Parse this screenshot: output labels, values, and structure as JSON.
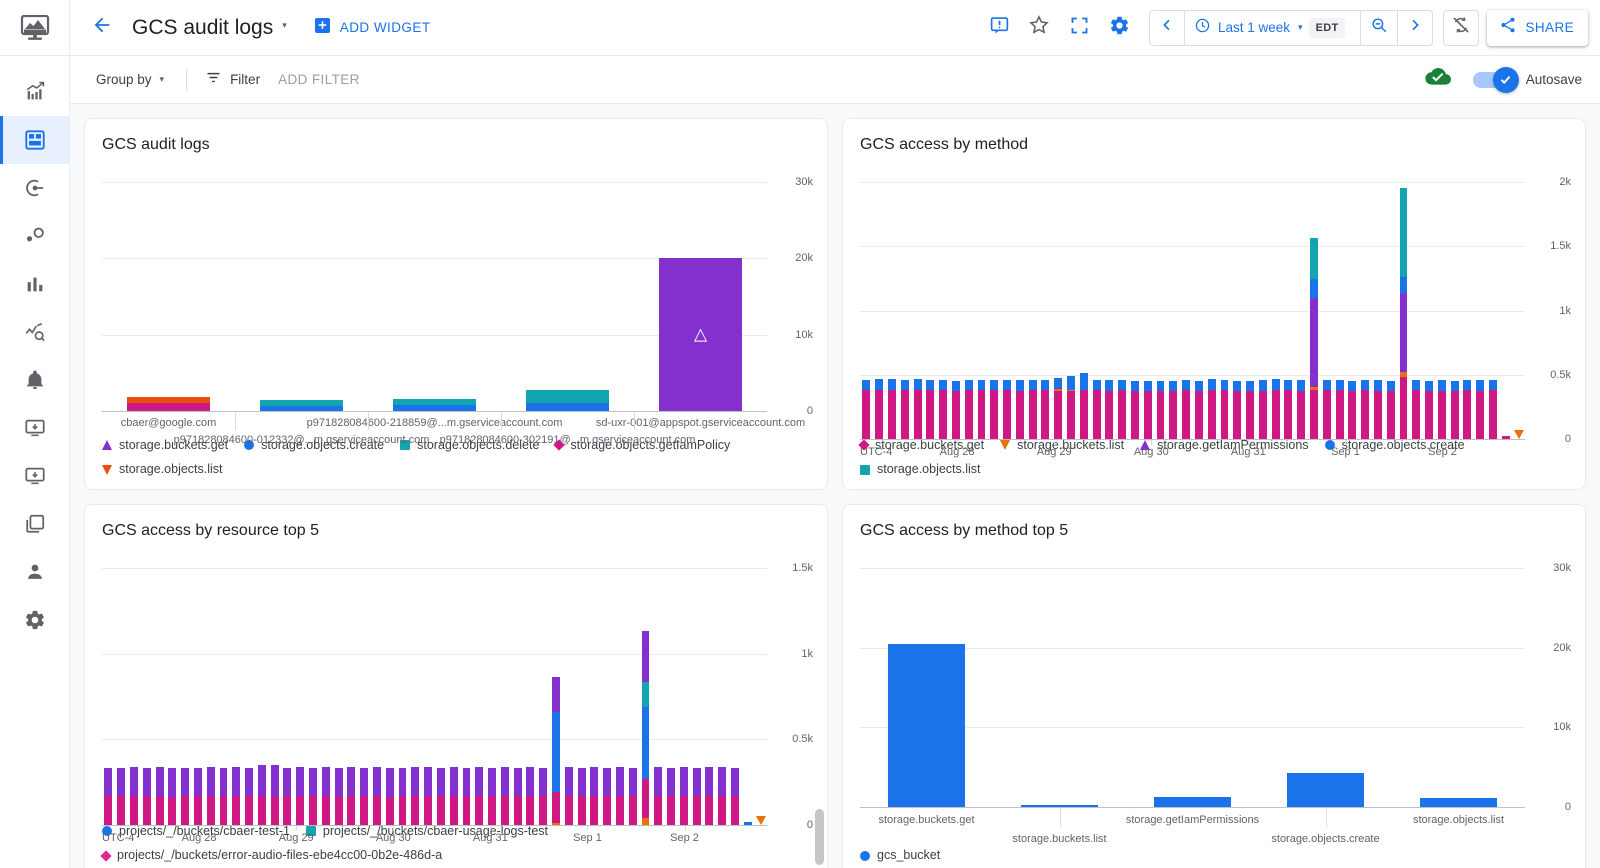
{
  "app": {
    "logo_icon": "monitoring-logo-icon"
  },
  "rail": {
    "items": [
      {
        "name": "overview",
        "icon": "chart-up-icon",
        "active": false
      },
      {
        "name": "dashboards",
        "icon": "dashboard-grid-icon",
        "active": true
      },
      {
        "name": "services",
        "icon": "target-arrow-icon",
        "active": false
      },
      {
        "name": "slo",
        "icon": "nodes-icon",
        "active": false
      },
      {
        "name": "metrics",
        "icon": "bar-chart-icon",
        "active": false
      },
      {
        "name": "explorer",
        "icon": "metric-explorer-icon",
        "active": false
      },
      {
        "name": "alerting",
        "icon": "bell-icon",
        "active": false
      },
      {
        "name": "uptime",
        "icon": "monitor-in-icon",
        "active": false
      },
      {
        "name": "groups",
        "icon": "monitor-in-2-icon",
        "active": false
      },
      {
        "name": "copies",
        "icon": "copy-icon",
        "active": false
      },
      {
        "name": "account",
        "icon": "person-icon",
        "active": false
      },
      {
        "name": "settings",
        "icon": "gear-icon",
        "active": false
      }
    ]
  },
  "topbar": {
    "back_icon": "arrow-back-icon",
    "title": "GCS audit logs",
    "title_caret": "▾",
    "add_widget_label": "ADD WIDGET",
    "add_widget_icon": "add-box-icon",
    "actions": [
      {
        "name": "feedback",
        "icon": "feedback-icon"
      },
      {
        "name": "star",
        "icon": "star-outline-icon"
      },
      {
        "name": "fullscreen",
        "icon": "fullscreen-icon"
      },
      {
        "name": "settings",
        "icon": "gear-icon"
      }
    ],
    "time_prev_icon": "chevron-left-icon",
    "time_clock_icon": "clock-icon",
    "time_range": "Last 1 week",
    "time_caret": "▾",
    "timezone": "EDT",
    "time_zoom_icon": "zoom-out-icon",
    "time_next_icon": "chevron-right-icon",
    "refresh_off_icon": "sync-disabled-icon",
    "share_icon": "share-icon",
    "share_label": "SHARE"
  },
  "filterbar": {
    "group_by_label": "Group by",
    "group_by_caret": "▾",
    "filter_icon": "filter-icon",
    "filter_label": "Filter",
    "add_filter_label": "ADD FILTER",
    "saved_icon": "cloud-done-icon",
    "autosave_label": "Autosave",
    "autosave_on": true
  },
  "colors": {
    "blue": "#1a73e8",
    "purple": "#8430ce",
    "magenta": "#d01884",
    "pink": "#e52592",
    "teal": "#12a4af",
    "orange": "#e8710a",
    "red_orange": "#e8500a",
    "green": "#188038",
    "grey_text": "#5f6368"
  },
  "chart_data": [
    {
      "id": "gcs-audit-logs",
      "type": "bar",
      "stacked": true,
      "title": "GCS audit logs",
      "xlabel": "",
      "ylabel": "",
      "ylim": [
        0,
        30000
      ],
      "yticks": [
        0,
        10000,
        20000,
        30000
      ],
      "ytick_labels": [
        "0",
        "10k",
        "20k",
        "30k"
      ],
      "grid": true,
      "legend_position": "bottom",
      "categories": [
        "cbaer@google.com",
        "p971828084600-012332@...m.gserviceaccount.com",
        "p971828084600-218859@...m.gserviceaccount.com",
        "p971828084600-302191@...m.gserviceaccount.com",
        "sd-uxr-001@appspot.gserviceaccount.com"
      ],
      "series": [
        {
          "name": "storage.buckets.get",
          "marker": "tri",
          "color": "#8430ce",
          "values": [
            0,
            0,
            0,
            0,
            20000
          ]
        },
        {
          "name": "storage.objects.create",
          "marker": "circle",
          "color": "#1a73e8",
          "values": [
            0,
            700,
            800,
            1100,
            0
          ]
        },
        {
          "name": "storage.objects.delete",
          "marker": "square",
          "color": "#12a4af",
          "values": [
            0,
            800,
            800,
            1600,
            0
          ]
        },
        {
          "name": "storage.objects.getIamPolicy",
          "marker": "diamond",
          "color": "#d01884",
          "values": [
            1000,
            0,
            0,
            0,
            0
          ]
        },
        {
          "name": "storage.objects.list",
          "marker": "tridown",
          "color": "#e8500a",
          "values": [
            800,
            0,
            0,
            0,
            0
          ]
        }
      ],
      "bar_glyph": "△",
      "bar_glyph_on_category": "sd-uxr-001@appspot.gserviceaccount.com"
    },
    {
      "id": "gcs-access-by-method",
      "type": "bar",
      "stacked": true,
      "title": "GCS access by method",
      "xlabel": "",
      "ylabel": "",
      "ylim": [
        0,
        2000
      ],
      "yticks": [
        0,
        500,
        1000,
        1500,
        2000
      ],
      "ytick_labels": [
        "0",
        "0.5k",
        "1k",
        "1.5k",
        "2k"
      ],
      "grid": true,
      "legend_position": "bottom",
      "xtick_labels": [
        "UTC-4",
        "Aug 28",
        "Aug 29",
        "Aug 30",
        "Aug 31",
        "Sep 1",
        "Sep 2"
      ],
      "xtick_positions": [
        0,
        14.6,
        29.2,
        43.8,
        58.4,
        73.0,
        87.6
      ],
      "n_bars": 48,
      "series_names": [
        "storage.buckets.get",
        "storage.buckets.list",
        "storage.getIamPermissions",
        "storage.objects.create",
        "storage.objects.list"
      ],
      "series_markers": [
        "diamond",
        "tridown",
        "tri",
        "circle",
        "square"
      ],
      "series_colors": [
        "#d01884",
        "#e8710a",
        "#8430ce",
        "#1a73e8",
        "#12a4af"
      ],
      "stacks": [
        [
          380,
          0,
          0,
          80,
          0
        ],
        [
          385,
          0,
          0,
          80,
          0
        ],
        [
          382,
          0,
          0,
          82,
          0
        ],
        [
          380,
          0,
          0,
          78,
          0
        ],
        [
          385,
          0,
          0,
          80,
          0
        ],
        [
          378,
          0,
          0,
          80,
          0
        ],
        [
          380,
          0,
          0,
          78,
          0
        ],
        [
          372,
          0,
          0,
          80,
          0
        ],
        [
          382,
          0,
          0,
          80,
          0
        ],
        [
          378,
          0,
          0,
          82,
          0
        ],
        [
          380,
          0,
          0,
          80,
          0
        ],
        [
          378,
          0,
          0,
          80,
          0
        ],
        [
          376,
          0,
          0,
          80,
          0
        ],
        [
          380,
          0,
          0,
          80,
          0
        ],
        [
          378,
          0,
          0,
          78,
          0
        ],
        [
          370,
          18,
          10,
          78,
          0
        ],
        [
          372,
          8,
          0,
          110,
          0
        ],
        [
          380,
          0,
          0,
          130,
          0
        ],
        [
          380,
          0,
          0,
          80,
          0
        ],
        [
          375,
          0,
          0,
          85,
          0
        ],
        [
          378,
          0,
          0,
          80,
          0
        ],
        [
          372,
          0,
          0,
          80,
          0
        ],
        [
          376,
          0,
          0,
          78,
          0
        ],
        [
          375,
          0,
          0,
          80,
          0
        ],
        [
          372,
          0,
          0,
          80,
          0
        ],
        [
          378,
          0,
          0,
          82,
          0
        ],
        [
          374,
          0,
          0,
          80,
          0
        ],
        [
          380,
          0,
          0,
          88,
          0
        ],
        [
          382,
          0,
          0,
          80,
          0
        ],
        [
          375,
          0,
          0,
          80,
          0
        ],
        [
          372,
          0,
          0,
          80,
          0
        ],
        [
          376,
          0,
          0,
          80,
          0
        ],
        [
          382,
          0,
          0,
          88,
          0
        ],
        [
          378,
          0,
          0,
          80,
          0
        ],
        [
          376,
          0,
          0,
          80,
          0
        ],
        [
          380,
          25,
          690,
          150,
          320
        ],
        [
          378,
          0,
          0,
          80,
          0
        ],
        [
          380,
          0,
          0,
          80,
          0
        ],
        [
          375,
          0,
          0,
          80,
          0
        ],
        [
          378,
          0,
          0,
          80,
          0
        ],
        [
          376,
          0,
          0,
          80,
          0
        ],
        [
          370,
          0,
          0,
          78,
          0
        ],
        [
          480,
          40,
          620,
          120,
          690
        ],
        [
          378,
          0,
          0,
          80,
          0
        ],
        [
          372,
          0,
          0,
          80,
          0
        ],
        [
          376,
          0,
          0,
          80,
          0
        ],
        [
          374,
          0,
          0,
          80,
          0
        ],
        [
          378,
          0,
          0,
          80,
          0
        ],
        [
          376,
          0,
          0,
          80,
          0
        ],
        [
          380,
          0,
          0,
          80,
          0
        ],
        [
          25,
          0,
          0,
          0,
          0
        ]
      ],
      "end_marker": {
        "icon": "tridown",
        "color": "#e8710a"
      }
    },
    {
      "id": "gcs-access-by-resource-top-5",
      "type": "bar",
      "stacked": true,
      "title": "GCS access by resource top 5",
      "xlabel": "",
      "ylabel": "",
      "ylim": [
        0,
        1500
      ],
      "yticks": [
        0,
        500,
        1000,
        1500
      ],
      "ytick_labels": [
        "0",
        "0.5k",
        "1k",
        "1.5k"
      ],
      "grid": true,
      "legend_position": "bottom",
      "xtick_labels": [
        "UTC-4",
        "Aug 28",
        "Aug 29",
        "Aug 30",
        "Aug 31",
        "Sep 1",
        "Sep 2"
      ],
      "xtick_positions": [
        0,
        14.6,
        29.2,
        43.8,
        58.4,
        73.0,
        87.6
      ],
      "n_bars": 48,
      "series_names": [
        "projects/_/buckets/cbaer-test-1",
        "projects/_/buckets/cbaer-usage-logs-test",
        "projects/_/buckets/error-audio-files-ebe4cc00-0b2e-486d-a"
      ],
      "series_markers": [
        "circle",
        "square",
        "diamond"
      ],
      "series_colors": [
        "#1a73e8",
        "#12a4af",
        "#e52592"
      ],
      "stack_colors": [
        "#1a73e8",
        "#12a4af",
        "#e8710a",
        "#d01884",
        "#8430ce"
      ],
      "stacks": [
        [
          0,
          0,
          0,
          170,
          165
        ],
        [
          0,
          0,
          0,
          170,
          165
        ],
        [
          0,
          0,
          0,
          168,
          168
        ],
        [
          0,
          0,
          0,
          170,
          165
        ],
        [
          0,
          0,
          0,
          170,
          168
        ],
        [
          0,
          0,
          0,
          165,
          170
        ],
        [
          0,
          0,
          0,
          170,
          165
        ],
        [
          0,
          0,
          0,
          168,
          165
        ],
        [
          0,
          0,
          0,
          170,
          168
        ],
        [
          0,
          0,
          0,
          170,
          165
        ],
        [
          0,
          0,
          0,
          168,
          170
        ],
        [
          0,
          0,
          0,
          170,
          165
        ],
        [
          0,
          0,
          0,
          170,
          180
        ],
        [
          0,
          0,
          0,
          170,
          182
        ],
        [
          0,
          0,
          0,
          168,
          165
        ],
        [
          0,
          0,
          0,
          170,
          168
        ],
        [
          0,
          0,
          0,
          170,
          165
        ],
        [
          0,
          0,
          0,
          168,
          168
        ],
        [
          0,
          0,
          0,
          170,
          165
        ],
        [
          0,
          0,
          0,
          168,
          170
        ],
        [
          0,
          0,
          0,
          170,
          165
        ],
        [
          0,
          0,
          0,
          170,
          168
        ],
        [
          0,
          0,
          0,
          165,
          170
        ],
        [
          0,
          0,
          0,
          170,
          165
        ],
        [
          0,
          0,
          0,
          168,
          168
        ],
        [
          0,
          0,
          0,
          170,
          168
        ],
        [
          0,
          0,
          0,
          170,
          165
        ],
        [
          0,
          0,
          0,
          168,
          170
        ],
        [
          0,
          0,
          0,
          170,
          165
        ],
        [
          0,
          0,
          0,
          170,
          168
        ],
        [
          0,
          0,
          0,
          168,
          165
        ],
        [
          0,
          0,
          0,
          170,
          170
        ],
        [
          0,
          0,
          0,
          168,
          165
        ],
        [
          0,
          0,
          0,
          170,
          168
        ],
        [
          0,
          0,
          0,
          170,
          165
        ],
        [
          470,
          0,
          12,
          180,
          200
        ],
        [
          0,
          0,
          0,
          170,
          168
        ],
        [
          0,
          0,
          0,
          168,
          165
        ],
        [
          0,
          0,
          0,
          170,
          168
        ],
        [
          0,
          0,
          0,
          170,
          165
        ],
        [
          0,
          0,
          0,
          168,
          170
        ],
        [
          0,
          0,
          0,
          170,
          165
        ],
        [
          420,
          145,
          40,
          230,
          300
        ],
        [
          0,
          0,
          0,
          170,
          168
        ],
        [
          0,
          0,
          0,
          168,
          165
        ],
        [
          0,
          0,
          0,
          170,
          168
        ],
        [
          0,
          0,
          0,
          170,
          165
        ],
        [
          0,
          0,
          0,
          168,
          170
        ],
        [
          0,
          0,
          0,
          170,
          168
        ],
        [
          0,
          0,
          0,
          170,
          165
        ],
        [
          18,
          0,
          0,
          0,
          0
        ]
      ],
      "end_marker": {
        "icon": "tridown",
        "color": "#e8710a"
      }
    },
    {
      "id": "gcs-access-by-method-top-5",
      "type": "bar",
      "stacked": false,
      "title": "GCS access by method top 5",
      "xlabel": "",
      "ylabel": "",
      "ylim": [
        0,
        30000
      ],
      "yticks": [
        0,
        10000,
        20000,
        30000
      ],
      "ytick_labels": [
        "0",
        "10k",
        "20k",
        "30k"
      ],
      "grid": true,
      "legend_position": "bottom",
      "categories": [
        "storage.buckets.get",
        "storage.buckets.list",
        "storage.getIamPermissions",
        "storage.objects.create",
        "storage.objects.list"
      ],
      "values": [
        20400,
        150,
        1250,
        4300,
        1100
      ],
      "series": [
        {
          "name": "gcs_bucket",
          "marker": "circle",
          "color": "#1a73e8"
        }
      ]
    }
  ],
  "scrollbar": {
    "present": true
  }
}
